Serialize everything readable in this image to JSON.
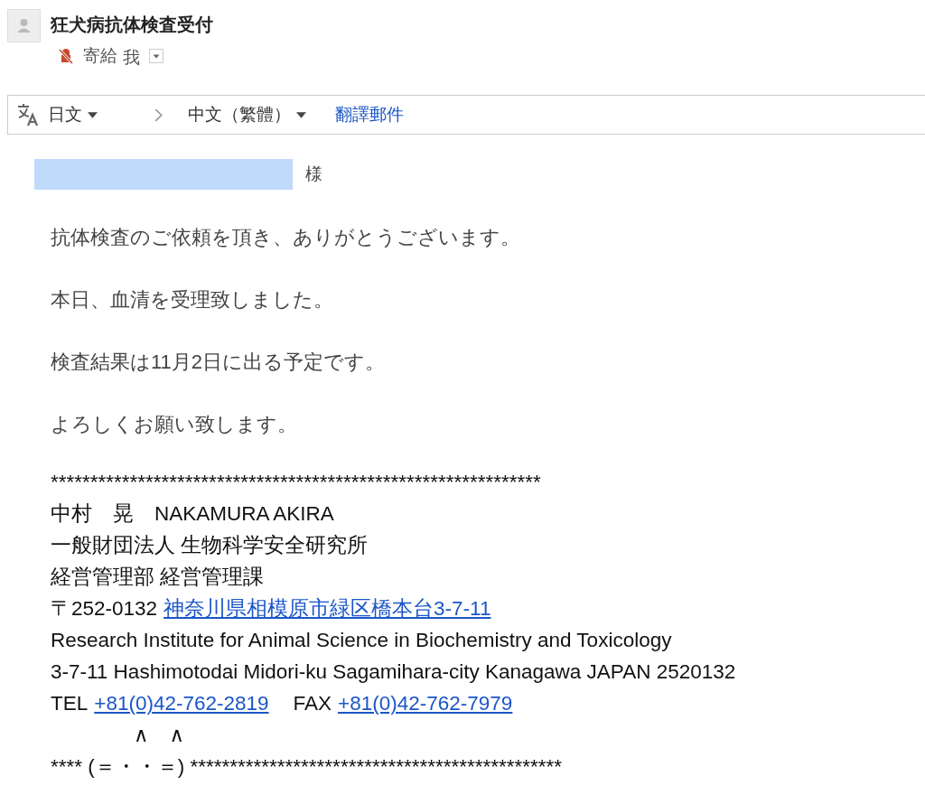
{
  "header": {
    "subject": "狂犬病抗体検査受付",
    "to_label": "寄給",
    "recipient": "我"
  },
  "translate_bar": {
    "source_language": "日文",
    "target_language": "中文（繁體）",
    "action": "翻譯郵件"
  },
  "body": {
    "salutation": "様",
    "paragraphs": [
      "抗体検査のご依頼を頂き、ありがとうございます。",
      "本日、血清を受理致しました。",
      "検査結果は11月2日に出る予定です。",
      "よろしくお願い致します。"
    ],
    "signature": [
      [
        {
          "kind": "text",
          "text": "**************************************************************"
        }
      ],
      [
        {
          "kind": "text",
          "text": "中村　晃　NAKAMURA AKIRA"
        }
      ],
      [
        {
          "kind": "text",
          "text": "一般財団法人 生物科学安全研究所"
        }
      ],
      [
        {
          "kind": "text",
          "text": "経営管理部 経営管理課"
        }
      ],
      [
        {
          "kind": "text",
          "text": "〒252-0132"
        },
        {
          "kind": "link",
          "text": "神奈川県相模原市緑区橋本台3-7-11"
        }
      ],
      [
        {
          "kind": "text",
          "text": "Research Institute for Animal Science in Biochemistry and Toxicology"
        }
      ],
      [
        {
          "kind": "text",
          "text": "3-7-11 Hashimotodai Midori-ku Sagamihara-city Kanagawa JAPAN 2520132"
        }
      ],
      [
        {
          "kind": "text",
          "text": "TEL"
        },
        {
          "kind": "link",
          "text": "+81(0)42-762-2819"
        },
        {
          "kind": "text",
          "text": "FAX"
        },
        {
          "kind": "link",
          "text": "+81(0)42-762-7979"
        }
      ],
      [
        {
          "kind": "text",
          "text": "　　　　∧　∧"
        }
      ],
      [
        {
          "kind": "text",
          "text": "**** (＝・・＝) ***********************************************"
        }
      ]
    ]
  }
}
